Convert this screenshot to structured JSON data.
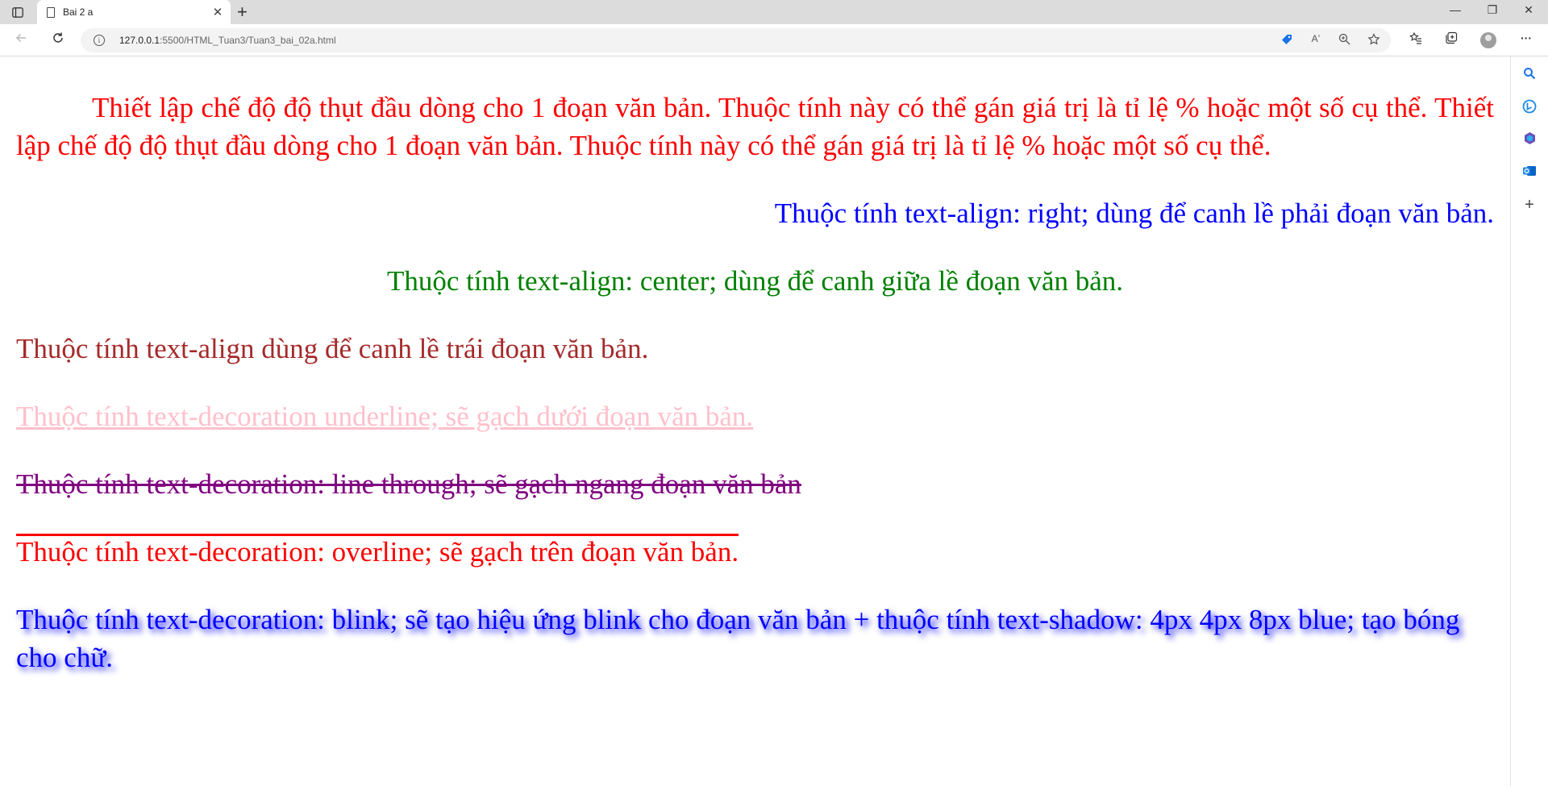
{
  "browser": {
    "tab_title": "Bai 2 a",
    "close_glyph": "✕",
    "newtab_glyph": "+",
    "url_host": "127.0.0.1",
    "url_rest": ":5500/HTML_Tuan3/Tuan3_bai_02a.html",
    "info_glyph": "i",
    "read_aloud_label": "Aʼ",
    "window_controls": [
      "—",
      "❐",
      "✕"
    ],
    "more_glyph": "···"
  },
  "content": {
    "p1": "Thiết lập chế độ độ thụt đầu dòng cho 1 đoạn văn bản. Thuộc tính này có thể gán giá trị là tỉ lệ % hoặc một số cụ thể. Thiết lập chế độ độ thụt đầu dòng cho 1 đoạn văn bản. Thuộc tính này có thể gán giá trị là tỉ lệ % hoặc một số cụ thể.",
    "p2": "Thuộc tính text-align: right; dùng để canh lề phải đoạn văn bản.",
    "p3": "Thuộc tính text-align: center; dùng để canh giữa lề đoạn văn bản.",
    "p4": "Thuộc tính text-align dùng để canh lề trái đoạn văn bản.",
    "p5": "Thuộc tính text-decoration underline; sẽ gạch dưới đoạn văn bản.",
    "p6": "Thuộc tính text-decoration: line through; sẽ gạch ngang đoạn văn bản",
    "p7": "Thuộc tính text-decoration: overline; sẽ gạch trên đoạn văn bản.",
    "p8": "Thuộc tính text-decoration: blink; sẽ tạo hiệu ứng blink cho đoạn văn bản + thuộc tính text-shadow: 4px 4px 8px blue; tạo bóng cho chữ."
  },
  "colors": {
    "p1": "#ff0000",
    "p2": "#0000ff",
    "p3": "#008000",
    "p4": "#a52a2a",
    "p5": "#ffc0cb",
    "p6": "#800080",
    "p7": "#ff0000",
    "p8": "#0000ff"
  }
}
